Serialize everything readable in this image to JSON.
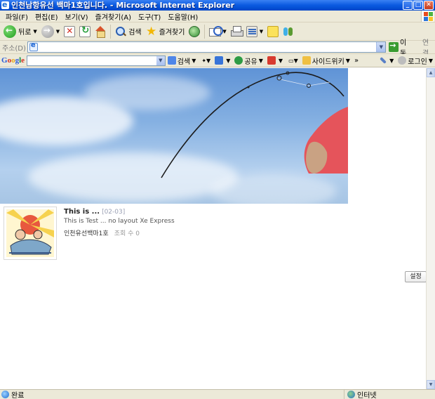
{
  "window": {
    "title": "인천남항유선 백마1호입니다. - Microsoft Internet Explorer",
    "controls": [
      "minimize",
      "maximize",
      "close"
    ]
  },
  "menu": {
    "items": [
      "파일(F)",
      "편집(E)",
      "보기(V)",
      "즐겨찾기(A)",
      "도구(T)",
      "도움말(H)"
    ]
  },
  "toolbar": {
    "back_label": "뒤로",
    "search_label": "검색",
    "favorites_label": "즐겨찾기",
    "icons": [
      "back-icon",
      "forward-icon",
      "stop-icon",
      "refresh-icon",
      "home-icon",
      "search-icon",
      "favorites-star-icon",
      "media-icon",
      "mail-icon",
      "print-icon",
      "edit-icon",
      "discuss-icon",
      "messenger-icon"
    ]
  },
  "address": {
    "label": "주소(D)",
    "value": "",
    "go_label": "이동",
    "links_label": "연결"
  },
  "google_toolbar": {
    "logo": "Google",
    "search_value": "",
    "search_button": "검색",
    "share_label": "공유",
    "sidewiki_label": "사이드위키",
    "more_label": "»",
    "login_label": "로그인"
  },
  "content": {
    "post": {
      "title": "This is ...",
      "date": "[02-03]",
      "summary": "This is Test ... no layout Xe Express",
      "author": "인천유선백마1호",
      "views_label": "조회 수",
      "views_count": "0"
    },
    "settings_button": "설정"
  },
  "status": {
    "text": "완료",
    "zone": "인터넷"
  },
  "colors": {
    "titlebar": "#0a5ae0",
    "chrome": "#ece9d8",
    "sky": "#86b1e2",
    "shirt": "#e8505b"
  }
}
